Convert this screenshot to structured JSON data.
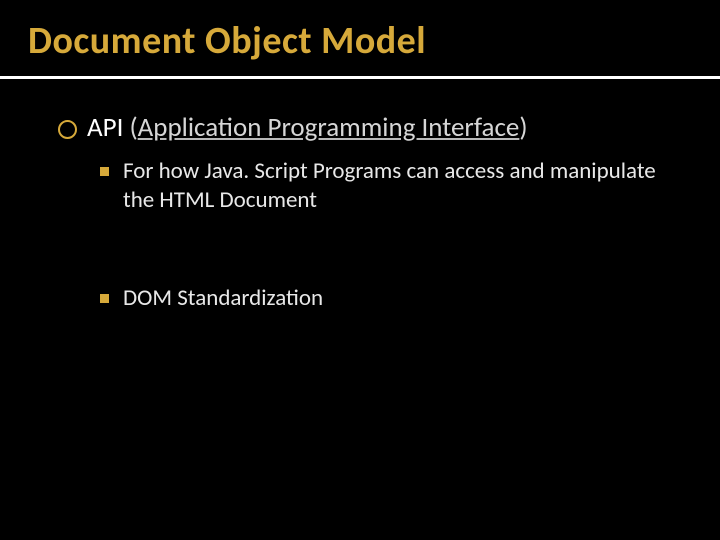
{
  "title": "Document Object Model",
  "lvl1": {
    "prefix": "API ",
    "paren_open": "(",
    "underlined": "Application Programming Interface",
    "paren_close": ")"
  },
  "lvl2": [
    "For how Java. Script Programs can access and manipulate the HTML Document",
    "DOM Standardization"
  ]
}
